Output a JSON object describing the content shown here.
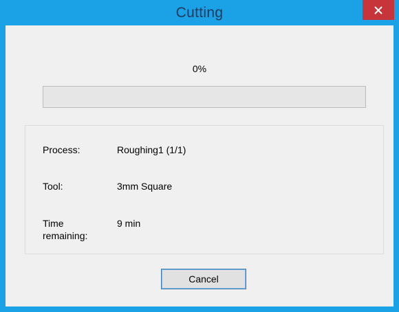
{
  "window": {
    "title": "Cutting",
    "close_icon": "close-icon"
  },
  "progress": {
    "percent_text": "0%",
    "value": 0
  },
  "info": {
    "process_label": "Process:",
    "process_value": "Roughing1 (1/1)",
    "tool_label": "Tool:",
    "tool_value": "3mm Square",
    "time_label": "Time remaining:",
    "time_value": "9 min"
  },
  "actions": {
    "cancel_label": "Cancel"
  },
  "colors": {
    "frame": "#1aa1e6",
    "close_button": "#c7343a",
    "client_bg": "#f0f0f0",
    "progress_fill": "#06b025"
  }
}
